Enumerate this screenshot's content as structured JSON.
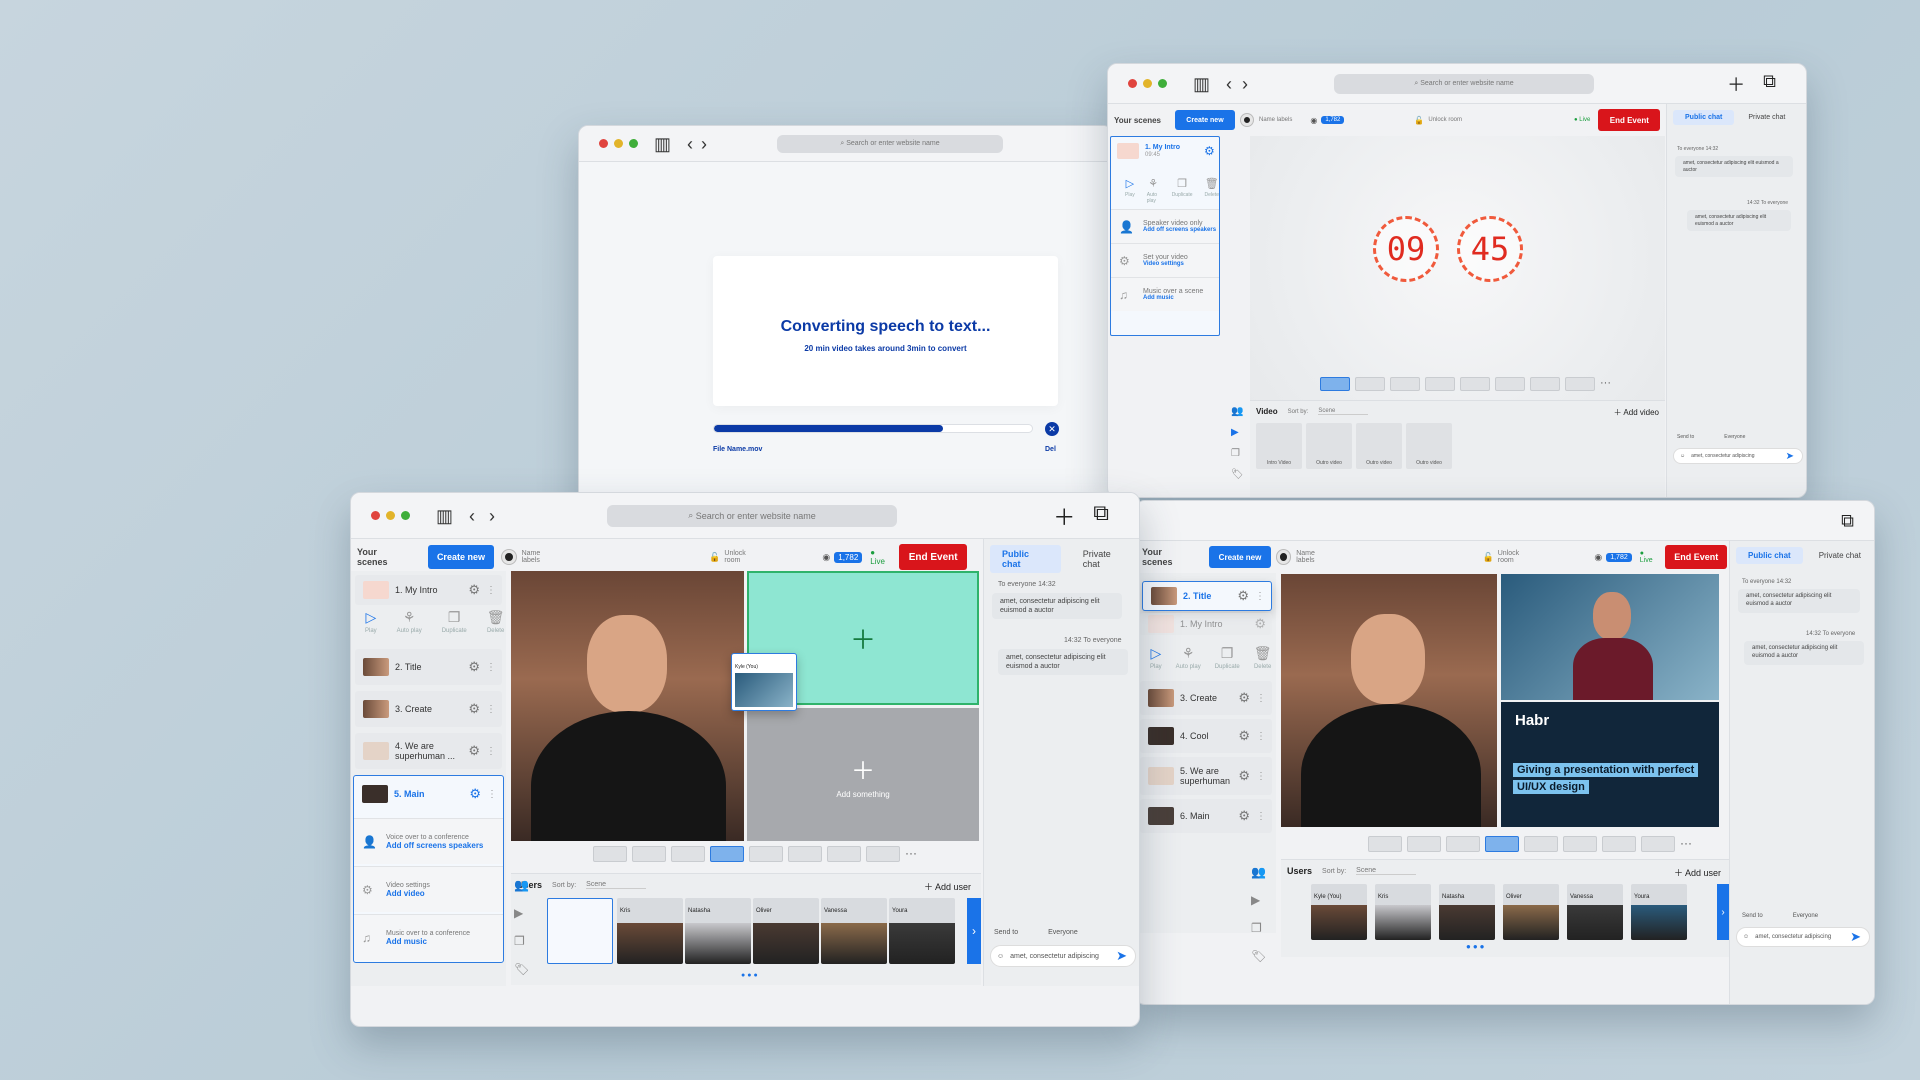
{
  "browser": {
    "search_placeholder": "Search or enter website name"
  },
  "converter": {
    "title": "Converting speech to text...",
    "subtitle": "20 min video takes around 3min to convert",
    "file_name": "File Name.mov",
    "del_label": "Del",
    "progress": 0.72
  },
  "header": {
    "your_scenes": "Your scenes",
    "create_new": "Create new",
    "name_labels": "Name labels",
    "viewers": "1,782",
    "unlock_room": "Unlock room",
    "live": "Live",
    "end_event": "End Event"
  },
  "chat": {
    "public": "Public chat",
    "private": "Private chat",
    "to_everyone": "To everyone",
    "time": "14:32",
    "message": "amet, consectetur adipiscing elit euismod a auctor",
    "send_to_label": "Send to",
    "send_to_value": "Everyone",
    "input_text": "amet, consectetur adipiscing"
  },
  "tools": {
    "play": "Play",
    "auto_play": "Auto play",
    "duplicate": "Duplicate",
    "delete": "Delete"
  },
  "scenes": [
    {
      "name": "1. My Intro"
    },
    {
      "name": "2. Title"
    },
    {
      "name": "3. Create"
    },
    {
      "name": "4. We are superhuman ..."
    },
    {
      "name": "5. Main"
    },
    {
      "name": "4. Cool"
    },
    {
      "name": "5. We are superhuman"
    },
    {
      "name": "6. Main"
    }
  ],
  "scene_options": {
    "voice_small": "Voice over to a conference",
    "voice_link": "Add off screens speakers",
    "speaker_small": "Speaker video only",
    "video_small": "Video settings",
    "video_link": "Add video",
    "video_small2": "Set your video",
    "video_link2": "Video settings",
    "music_small": "Music over to a conference",
    "music_small2": "Music over a scene",
    "music_link": "Add music"
  },
  "intro_time": "09:45",
  "timer": {
    "minutes": "09",
    "seconds": "45"
  },
  "stage": {
    "add_something": "Add something",
    "pip_name": "Kyle (You)"
  },
  "users": {
    "title": "Users",
    "sort_label": "Sort by:",
    "sort_value": "Scene",
    "add_user": "Add user",
    "list": [
      "Kris",
      "Natasha",
      "Oliver",
      "Vanessa",
      "Youra"
    ],
    "list2": [
      "Kyle (You)",
      "Kris",
      "Natasha",
      "Oliver",
      "Vanessa",
      "Youra"
    ]
  },
  "video_panel": {
    "title": "Video",
    "sort_label": "Sort by:",
    "sort_value": "Scene",
    "add_video": "Add video",
    "items": [
      "Intro Video",
      "Outro video",
      "Outro video",
      "Outro video"
    ]
  },
  "overlay": {
    "brand": "Habr",
    "caption_line1": "Giving a presentation with perfect",
    "caption_line2": "UI/UX design"
  }
}
